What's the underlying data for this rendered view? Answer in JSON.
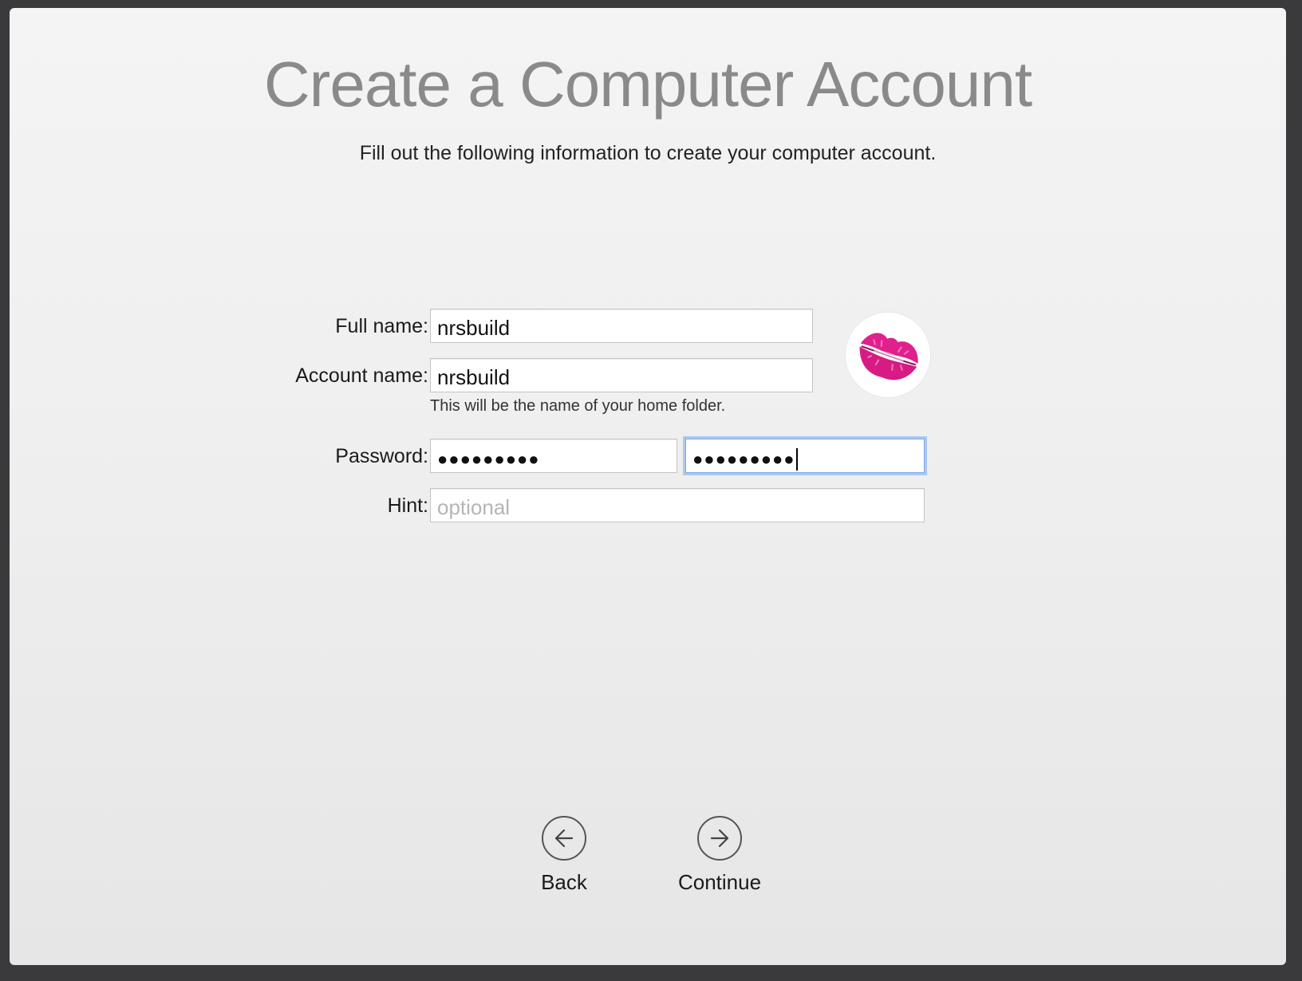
{
  "page": {
    "title": "Create a Computer Account",
    "subtitle": "Fill out the following information to create your computer account."
  },
  "form": {
    "full_name_label": "Full name:",
    "full_name_value": "nrsbuild",
    "account_name_label": "Account name:",
    "account_name_value": "nrsbuild",
    "account_name_hint": "This will be the name of your home folder.",
    "password_label": "Password:",
    "password_value": "●●●●●●●●●",
    "verify_value": "●●●●●●●●●",
    "hint_label": "Hint:",
    "hint_placeholder": "optional"
  },
  "avatar": {
    "icon": "lips-kiss-icon",
    "color": "#e0208c"
  },
  "nav": {
    "back_label": "Back",
    "continue_label": "Continue"
  }
}
